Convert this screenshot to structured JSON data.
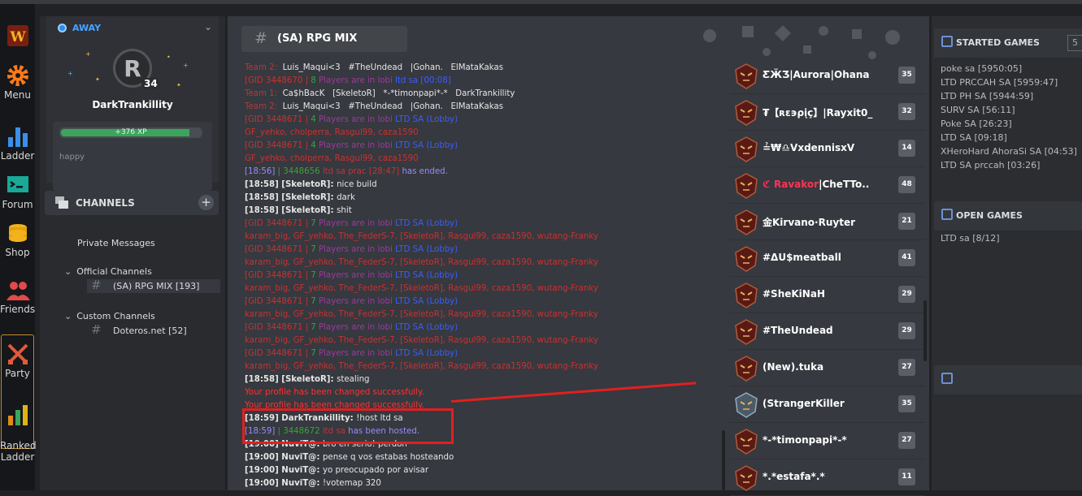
{
  "left_rail": [
    {
      "label": "Menu",
      "icon": "gear-icon"
    },
    {
      "label": "Ladder",
      "icon": "bar-chart-icon"
    },
    {
      "label": "Forum",
      "icon": "forum-icon"
    },
    {
      "label": "Shop",
      "icon": "coins-icon"
    },
    {
      "label": "Friends",
      "icon": "friends-icon"
    },
    {
      "label": "Party",
      "icon": "crossed-swords-icon"
    },
    {
      "label": "Ranked\nLadder",
      "icon": "ranked-ladder-icon"
    }
  ],
  "profile": {
    "status": "AWAY",
    "avatar_letter": "R",
    "level": "34",
    "username": "DarkTrankillity",
    "xp": "+376 XP",
    "xp_fraction": 0.92,
    "motto": "happy"
  },
  "channels": {
    "title": "CHANNELS",
    "private": "Private Messages",
    "official": "Official Channels",
    "official_item": "(SA) RPG MIX [193]",
    "custom": "Custom Channels",
    "custom_item": "Doteros.net [52]"
  },
  "header": {
    "title": "(SA) RPG MIX"
  },
  "colors": {
    "accent_blue": "#4aa3ff",
    "xp_green": "#3ba55c",
    "highlight_red": "#e02020"
  },
  "log": [
    [
      [
        "teamred",
        "Team 2:  "
      ],
      [
        "white",
        "Luis_Maqui<3   #TheUndead   |Gohan.   ElMataKakas"
      ]
    ],
    [
      [
        "red",
        "[GID 3448670 | "
      ],
      [
        "green",
        "8 "
      ],
      [
        "purple",
        "Players are in lobi "
      ],
      [
        "blue",
        "ltd sa [00:08]"
      ]
    ],
    [
      [
        "teamred",
        "Team 1:  "
      ],
      [
        "white",
        "Ca$hBacK   [SkeletoR]   *-*timonpapi*-*   DarkTrankillity"
      ]
    ],
    [
      [
        "teamred",
        "Team 2:  "
      ],
      [
        "white",
        "Luis_Maqui<3   #TheUndead   |Gohan.   ElMataKakas"
      ]
    ],
    [
      [
        "red",
        "[GID 3448671 | "
      ],
      [
        "green",
        "4 "
      ],
      [
        "purple",
        "Players are in lobi "
      ],
      [
        "blue",
        "LTD SA (Lobby)"
      ]
    ],
    [
      [
        "red",
        "GF_yehko, cholperra, Rasgul99, caza1590"
      ]
    ],
    [
      [
        "red",
        "[GID 3448671 | "
      ],
      [
        "green",
        "4 "
      ],
      [
        "purple",
        "Players are in lobi "
      ],
      [
        "blue",
        "LTD SA (Lobby)"
      ]
    ],
    [
      [
        "red",
        "GF_yehko, cholperra, Rasgul99, caza1590"
      ]
    ],
    [
      [
        "lav",
        "[18:56] "
      ],
      [
        "green",
        "| 3448656 "
      ],
      [
        "red",
        "ltd sa prac [28:47] "
      ],
      [
        "lav",
        "has ended."
      ]
    ],
    [
      [
        "white bold",
        "[18:58] [SkeletoR]: "
      ],
      [
        "white",
        "nice build"
      ]
    ],
    [
      [
        "white bold",
        "[18:58] [SkeletoR]: "
      ],
      [
        "white",
        "dark"
      ]
    ],
    [
      [
        "white bold",
        "[18:58] [SkeletoR]: "
      ],
      [
        "white",
        "shit"
      ]
    ],
    [
      [
        "red",
        "[GID 3448671 | "
      ],
      [
        "green",
        "7 "
      ],
      [
        "purple",
        "Players are in lobi "
      ],
      [
        "blue",
        "LTD SA (Lobby)"
      ]
    ],
    [
      [
        "red",
        "karam_big, GF_yehko, The_FederS-7, [SkeletoR], Rasgul99, caza1590, wutang-Franky"
      ]
    ],
    [
      [
        "red",
        "[GID 3448671 | "
      ],
      [
        "green",
        "7 "
      ],
      [
        "purple",
        "Players are in lobi "
      ],
      [
        "blue",
        "LTD SA (Lobby)"
      ]
    ],
    [
      [
        "red",
        "karam_big, GF_yehko, The_FederS-7, [SkeletoR], Rasgul99, caza1590, wutang-Franky"
      ]
    ],
    [
      [
        "red",
        "[GID 3448671 | "
      ],
      [
        "green",
        "7 "
      ],
      [
        "purple",
        "Players are in lobi "
      ],
      [
        "blue",
        "LTD SA (Lobby)"
      ]
    ],
    [
      [
        "red",
        "karam_big, GF_yehko, The_FederS-7, [SkeletoR], Rasgul99, caza1590, wutang-Franky"
      ]
    ],
    [
      [
        "red",
        "[GID 3448671 | "
      ],
      [
        "green",
        "7 "
      ],
      [
        "purple",
        "Players are in lobi "
      ],
      [
        "blue",
        "LTD SA (Lobby)"
      ]
    ],
    [
      [
        "red",
        "karam_big, GF_yehko, The_FederS-7, [SkeletoR], Rasgul99, caza1590, wutang-Franky"
      ]
    ],
    [
      [
        "red",
        "[GID 3448671 | "
      ],
      [
        "green",
        "7 "
      ],
      [
        "purple",
        "Players are in lobi "
      ],
      [
        "blue",
        "LTD SA (Lobby)"
      ]
    ],
    [
      [
        "red",
        "karam_big, GF_yehko, The_FederS-7, [SkeletoR], Rasgul99, caza1590, wutang-Franky"
      ]
    ],
    [
      [
        "red",
        "[GID 3448671 | "
      ],
      [
        "green",
        "7 "
      ],
      [
        "purple",
        "Players are in lobi "
      ],
      [
        "blue",
        "LTD SA (Lobby)"
      ]
    ],
    [
      [
        "red",
        "karam_big, GF_yehko, The_FederS-7, [SkeletoR], Rasgul99, caza1590, wutang-Franky"
      ]
    ],
    [
      [
        "white bold",
        "[18:58] [SkeletoR]: "
      ],
      [
        "white",
        "stealing"
      ]
    ],
    [
      [
        "brightred",
        "Your profile has been changed successfully."
      ]
    ],
    [
      [
        "brightred",
        "Your profile has been changed successfully."
      ]
    ],
    [
      [
        "white bold",
        "[18:59] DarkTrankillity: "
      ],
      [
        "white",
        "!host ltd sa"
      ]
    ],
    [
      [
        "lav",
        "[18:59] "
      ],
      [
        "green",
        "| 3448672 "
      ],
      [
        "red",
        "ltd sa "
      ],
      [
        "lav",
        "has been hosted."
      ]
    ],
    [
      [
        "white bold",
        "[19:00] NuviT@: "
      ],
      [
        "white",
        "bro en serio! perdon"
      ]
    ],
    [
      [
        "white bold",
        "[19:00] NuviT@: "
      ],
      [
        "white",
        "pense q vos estabas hosteando"
      ]
    ],
    [
      [
        "white bold",
        "[19:00] NuviT@: "
      ],
      [
        "white",
        "yo preocupado por avisar"
      ]
    ],
    [
      [
        "white bold",
        "[19:00] NuviT@: "
      ],
      [
        "white",
        "!votemap 320"
      ]
    ]
  ],
  "users": [
    {
      "name": "ƸӜƷ|Aurora|Ohana",
      "level": "35"
    },
    {
      "name": "₮【ʀɛ϶ρįç】|Rayxit0_",
      "level": "32"
    },
    {
      "name": "≟₩♎VxdennisxV",
      "level": "14"
    },
    {
      "name": "ℭ Ravakor|CheTTo..",
      "level": "48"
    },
    {
      "name": "金Kirvano·Ruyter",
      "level": "21"
    },
    {
      "name": "#ΔU$meatball",
      "level": "41"
    },
    {
      "name": "#SheKiNaH",
      "level": "29"
    },
    {
      "name": "#TheUndead",
      "level": "29"
    },
    {
      "name": "(New).tuka",
      "level": "27"
    },
    {
      "name": "(StrangerKiller",
      "level": "35"
    },
    {
      "name": "*-*timonpapi*-*",
      "level": "27"
    },
    {
      "name": "*.*estafa*.*",
      "level": "11"
    }
  ],
  "started_games": {
    "title": "STARTED GAMES",
    "items": [
      "poke sa [5950:05]",
      "LTD PRCCAH SA [5959:47]",
      "LTD PH SA [5944:59]",
      "SURV SA [56:11]",
      "Poke SA [26:23]",
      "LTD SA [09:18]",
      "XHeroHard AhoraSi SA [04:53]",
      "LTD SA prccah [03:26]"
    ]
  },
  "open_games": {
    "title": "OPEN GAMES",
    "items": [
      "LTD sa [8/12]"
    ]
  }
}
